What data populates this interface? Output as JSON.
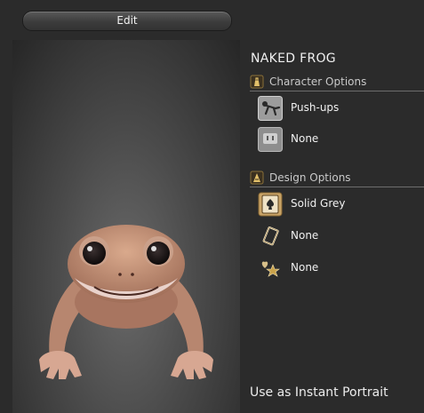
{
  "toolbar": {
    "edit_label": "Edit"
  },
  "portrait": {
    "name": "NAKED FROG"
  },
  "character_options": {
    "header": "Character Options",
    "icon": "gold-bag-icon",
    "items": [
      {
        "label": "Push-ups",
        "icon": "push-ups-icon"
      },
      {
        "label": "None",
        "icon": "blank-plug-icon"
      }
    ]
  },
  "design_options": {
    "header": "Design Options",
    "icon": "design-book-icon",
    "items": [
      {
        "label": "Solid Grey",
        "icon": "spade-card-icon"
      },
      {
        "label": "None",
        "icon": "frame-icon"
      },
      {
        "label": "None",
        "icon": "heart-star-icon"
      }
    ]
  },
  "footer": {
    "instant_portrait_label": "Use as Instant Portrait"
  },
  "colors": {
    "background": "#2b2b2b",
    "accent_gold": "#c9a24a",
    "divider": "#6d6d6d"
  }
}
